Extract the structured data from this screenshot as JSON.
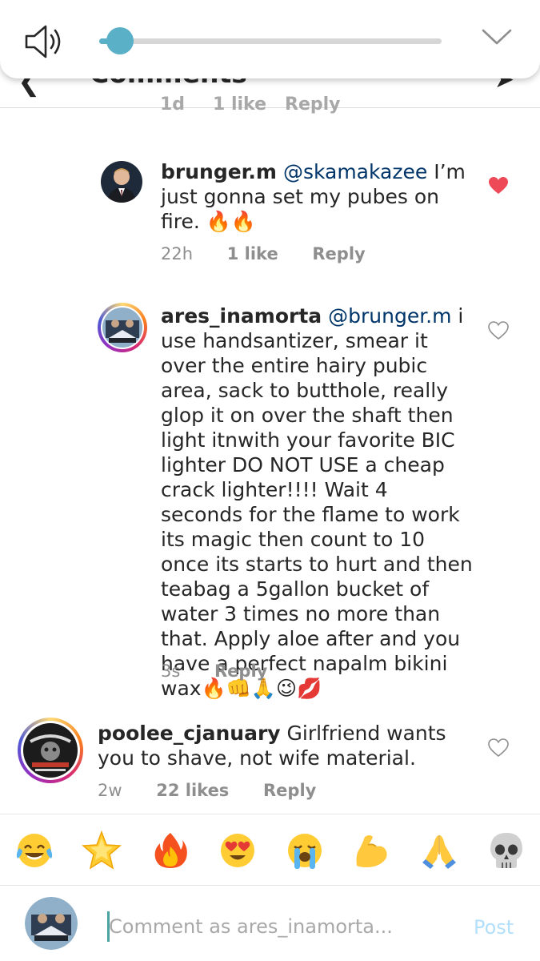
{
  "volume": {
    "level": 0.06,
    "speaker_icon": "speaker-icon",
    "collapse_icon": "chevron-down-icon"
  },
  "header": {
    "title": "Comments",
    "back_icon": "back-arrow-icon",
    "share_icon": "send-icon"
  },
  "peek_meta": {
    "time": "1d",
    "likes": "1 like",
    "reply": "Reply"
  },
  "comments": [
    {
      "username": "brunger.m",
      "mention": "@skamakazee",
      "text": " I’m just gonna set my pubes on fire. 🔥🔥",
      "time": "22h",
      "likes": "1 like",
      "reply": "Reply",
      "liked": true
    },
    {
      "username": "ares_inamorta",
      "mention": "@brunger.m",
      "text": " i use handsantizer, smear it over the entire hairy pubic area, sack to butthole, really glop it on over the shaft then light itnwith your favorite BIC lighter DO NOT USE a cheap crack lighter!!!! Wait 4 seconds for the flame to work its magic then count to 10 once its starts to hurt and then teabag a 5gallon bucket of water 3 times no more than that. Apply aloe after and you have a perfect napalm bikini wax🔥👊🙏😉💋",
      "time": "3s",
      "reply": "Reply",
      "liked": false
    },
    {
      "username": "poolee_cjanuary",
      "text": " Girlfriend wants you to shave, not wife material.",
      "time": "2w",
      "likes": "22 likes",
      "reply": "Reply",
      "liked": false
    }
  ],
  "emoji_bar": [
    "😂",
    "🌟",
    "🔥",
    "😍",
    "😭",
    "💪",
    "🙏",
    "💀"
  ],
  "composer": {
    "placeholder": "Comment as ares_inamorta...",
    "post_label": "Post"
  },
  "colors": {
    "accent": "#5ab0c6",
    "like_red": "#ed4956",
    "mention": "#003569",
    "meta_gray": "#8e8e8e",
    "post_disabled": "#b2dffc"
  }
}
